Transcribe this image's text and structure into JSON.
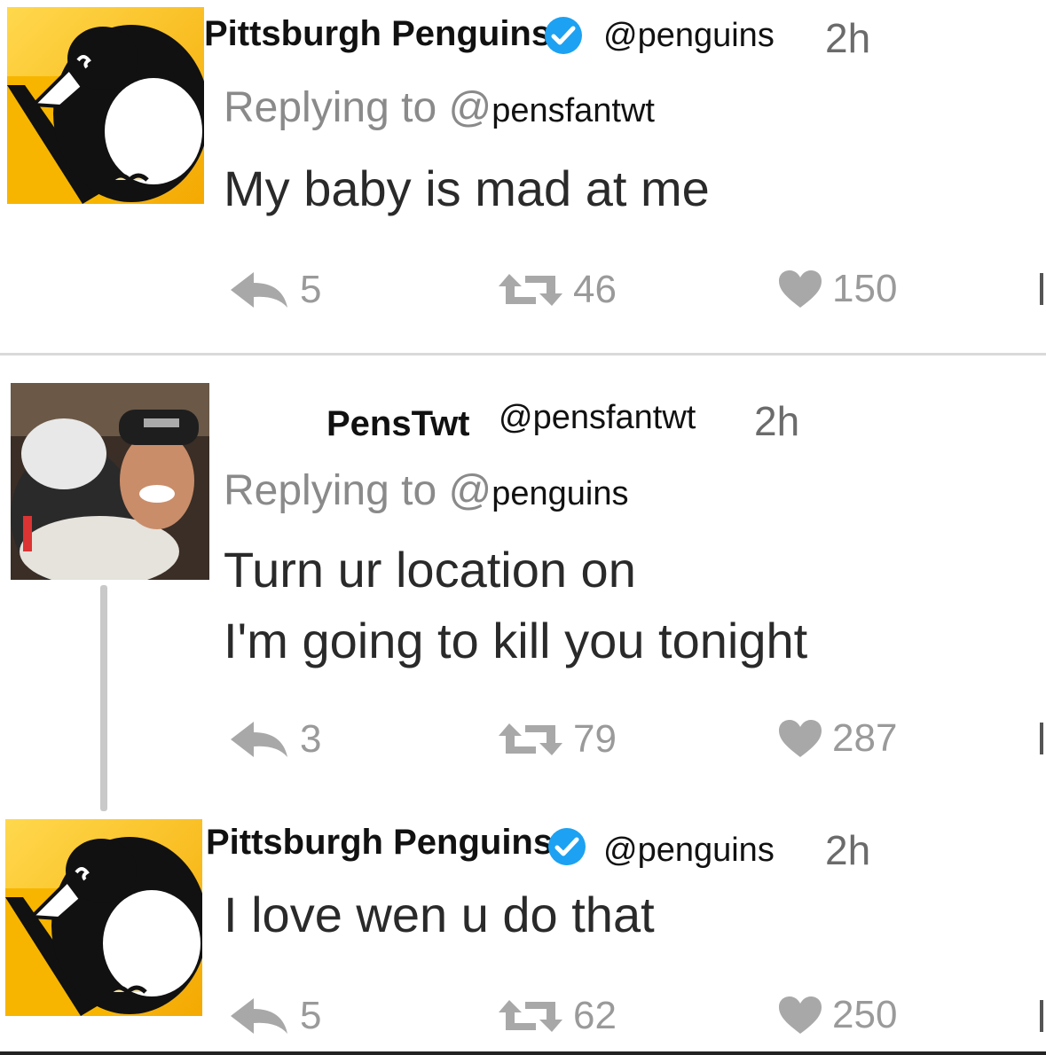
{
  "tweets": [
    {
      "display_name": "Pittsburgh Penguins",
      "handle": "@penguins",
      "time": "2h",
      "verified": true,
      "replying_prefix": "Replying to @",
      "replying_handle": "pensfantwt",
      "text": "My baby is mad at me",
      "replies": "5",
      "retweets": "46",
      "likes": "150",
      "avatar_icon": "penguins-logo"
    },
    {
      "display_name": "PensTwt",
      "handle": "@pensfantwt",
      "time": "2h",
      "verified": false,
      "replying_prefix": "Replying to @",
      "replying_handle": "penguins",
      "text_line1": "Turn ur location on",
      "text_line2": "I'm going to kill you tonight",
      "replies": "3",
      "retweets": "79",
      "likes": "287",
      "avatar_icon": "photo-avatar"
    },
    {
      "display_name": "Pittsburgh Penguins",
      "handle": "@penguins",
      "time": "2h",
      "verified": true,
      "text": "I love wen u do that",
      "replies": "5",
      "retweets": "62",
      "likes": "250",
      "avatar_icon": "penguins-logo"
    }
  ],
  "colors": {
    "penguins_gold": "#FCB514",
    "penguins_black": "#000000",
    "verified_blue": "#1DA1F2",
    "action_gray": "#9a9a9a"
  }
}
